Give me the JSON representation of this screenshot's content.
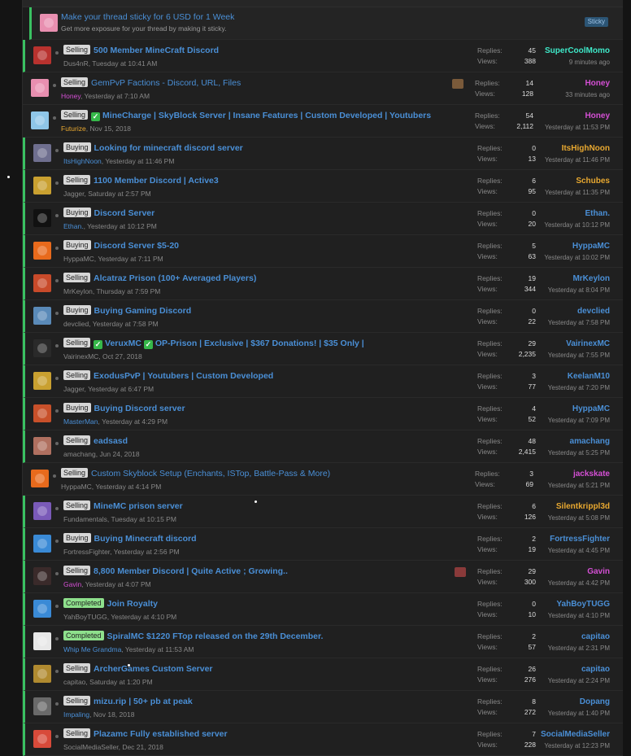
{
  "sticky_ad": {
    "title": "Make your thread sticky for 6 USD for 1 Week",
    "subtitle": "Get more exposure for your thread by making it sticky.",
    "button": "Sticky"
  },
  "labels": {
    "replies": "Replies:",
    "views": "Views:"
  },
  "threads": [
    {
      "prefix": "Selling",
      "title": "500 Member MineCraft Discord",
      "author": "Dus4nR",
      "author_color": "#888888",
      "date": "Tuesday at 10:41 AM",
      "replies": "45",
      "views": "388",
      "last_user": "SuperCoolMomo",
      "last_color": "#3ee8c8",
      "last_time": "9 minutes ago",
      "avatar": "#b8322e",
      "green": true
    },
    {
      "prefix": "Selling",
      "title": "GemPvP Factions - Discord, URL, Files",
      "normal": true,
      "author": "Honey",
      "author_color": "#d44fd4",
      "date": "Yesterday at 7:10 AM",
      "replies": "14",
      "views": "128",
      "last_user": "Honey",
      "last_color": "#d44fd4",
      "last_time": "33 minutes ago",
      "avatar": "#e88fb0",
      "tag": "#7a5a3a",
      "green": false
    },
    {
      "prefix": "Selling",
      "checks": [
        0
      ],
      "title_parts": [
        "MineCharge",
        "| SkyBlock Server | Insane Features | Custom Developed | Youtubers"
      ],
      "author": "Futurize",
      "author_color": "#e8a830",
      "date": "Nov 15, 2018",
      "replies": "54",
      "views": "2,112",
      "last_user": "Honey",
      "last_color": "#d44fd4",
      "last_time": "Yesterday at 11:53 PM",
      "avatar": "#8fc6e8",
      "green": false
    },
    {
      "prefix": "Buying",
      "title": "Looking for minecraft discord server",
      "author": "ItsHighNoon",
      "author_color": "#4a8fd6",
      "date": "Yesterday at 11:46 PM",
      "replies": "0",
      "views": "13",
      "last_user": "ItsHighNoon",
      "last_color": "#e8a830",
      "last_time": "Yesterday at 11:46 PM",
      "avatar": "#6f6f8f",
      "green": true
    },
    {
      "prefix": "Selling",
      "title": "1100 Member Discord | Active3",
      "author": "Jagger",
      "author_color": "#888888",
      "date": "Saturday at 2:57 PM",
      "replies": "6",
      "views": "95",
      "last_user": "Schubes",
      "last_color": "#e8a830",
      "last_time": "Yesterday at 11:35 PM",
      "avatar": "#c9a030",
      "green": true
    },
    {
      "prefix": "Buying",
      "title": "Discord Server",
      "author": "Ethan.",
      "author_color": "#4a8fd6",
      "date": "Yesterday at 10:12 PM",
      "replies": "0",
      "views": "20",
      "last_user": "Ethan.",
      "last_color": "#4a8fd6",
      "last_time": "Yesterday at 10:12 PM",
      "avatar": "#111111",
      "green": true
    },
    {
      "prefix": "Buying",
      "title": "Discord Server $5-20",
      "author": "HyppaMC",
      "author_color": "#888888",
      "date": "Yesterday at 7:11 PM",
      "replies": "5",
      "views": "63",
      "last_user": "HyppaMC",
      "last_color": "#4a8fd6",
      "last_time": "Yesterday at 10:02 PM",
      "avatar": "#e86a1c",
      "green": true
    },
    {
      "prefix": "Selling",
      "title": "Alcatraz Prison (100+ Averaged Players)",
      "author": "MrKeylon",
      "author_color": "#888888",
      "date": "Thursday at 7:59 PM",
      "replies": "19",
      "views": "344",
      "last_user": "MrKeylon",
      "last_color": "#4a8fd6",
      "last_time": "Yesterday at 8:04 PM",
      "avatar": "#c84a2a",
      "green": true
    },
    {
      "prefix": "Buying",
      "title": "Buying Gaming Discord",
      "author": "devclied",
      "author_color": "#888888",
      "date": "Yesterday at 7:58 PM",
      "replies": "0",
      "views": "22",
      "last_user": "devclied",
      "last_color": "#4a8fd6",
      "last_time": "Yesterday at 7:58 PM",
      "avatar": "#5a8ab8",
      "green": true
    },
    {
      "prefix": "Selling",
      "checks": [
        0,
        1
      ],
      "title_parts": [
        "VeruxMC",
        "OP-Prison | Exclusive | $367 Donations! | $35 Only |"
      ],
      "author": "VairinexMC",
      "author_color": "#888888",
      "date": "Oct 27, 2018",
      "replies": "29",
      "views": "2,235",
      "last_user": "VairinexMC",
      "last_color": "#4a8fd6",
      "last_time": "Yesterday at 7:55 PM",
      "avatar": "#2a2a2a",
      "green": true
    },
    {
      "prefix": "Selling",
      "title": "ExodusPvP | Youtubers | Custom Developed",
      "author": "Jagger",
      "author_color": "#888888",
      "date": "Yesterday at 6:47 PM",
      "replies": "3",
      "views": "77",
      "last_user": "KeelanM10",
      "last_color": "#4a8fd6",
      "last_time": "Yesterday at 7:20 PM",
      "avatar": "#c9a030",
      "green": true
    },
    {
      "prefix": "Buying",
      "title": "Buying Discord server",
      "author": "MasterMan",
      "author_color": "#4a8fd6",
      "date": "Yesterday at 4:29 PM",
      "replies": "4",
      "views": "52",
      "last_user": "HyppaMC",
      "last_color": "#4a8fd6",
      "last_time": "Yesterday at 7:09 PM",
      "avatar": "#c8502a",
      "green": true
    },
    {
      "prefix": "Selling",
      "title": "eadsasd",
      "author": "amachang",
      "author_color": "#888888",
      "date": "Jun 24, 2018",
      "replies": "48",
      "views": "2,415",
      "last_user": "amachang",
      "last_color": "#4a8fd6",
      "last_time": "Yesterday at 5:25 PM",
      "avatar": "#b07060",
      "green": true
    },
    {
      "prefix": "Selling",
      "title": "Custom Skyblock Setup (Enchants, ISTop, Battle-Pass & More)",
      "normal": true,
      "author": "HyppaMC",
      "author_color": "#888888",
      "date": "Yesterday at 4:14 PM",
      "replies": "3",
      "views": "69",
      "last_user": "jackskate",
      "last_color": "#d44fd4",
      "last_time": "Yesterday at 5:21 PM",
      "avatar": "#e86a1c",
      "green": false
    },
    {
      "prefix": "Selling",
      "title": "MineMC prison server",
      "author": "Fundamentals",
      "author_color": "#888888",
      "date": "Tuesday at 10:15 PM",
      "replies": "6",
      "views": "126",
      "last_user": "Silentkrippl3d",
      "last_color": "#e8a830",
      "last_time": "Yesterday at 5:08 PM",
      "avatar": "#7a5ab8",
      "green": true
    },
    {
      "prefix": "Buying",
      "title": "Buying Minecraft discord",
      "author": "FortressFighter",
      "author_color": "#888888",
      "date": "Yesterday at 2:56 PM",
      "replies": "2",
      "views": "19",
      "last_user": "FortressFighter",
      "last_color": "#4a8fd6",
      "last_time": "Yesterday at 4:45 PM",
      "avatar": "#3a8ad6",
      "green": true
    },
    {
      "prefix": "Selling",
      "title": "8,800 Member Discord | Quite Active ; Growing..",
      "author": "Gavin",
      "author_color": "#d44fd4",
      "date": "Yesterday at 4:07 PM",
      "replies": "29",
      "views": "300",
      "last_user": "Gavin",
      "last_color": "#d44fd4",
      "last_time": "Yesterday at 4:42 PM",
      "avatar": "#3a2a2a",
      "tag": "#8a3a3a",
      "green": true
    },
    {
      "prefix": "Completed",
      "title": "Join Royalty",
      "author": "YahBoyTUGG",
      "author_color": "#888888",
      "date": "Yesterday at 4:10 PM",
      "replies": "0",
      "views": "10",
      "last_user": "YahBoyTUGG",
      "last_color": "#4a8fd6",
      "last_time": "Yesterday at 4:10 PM",
      "avatar": "#3a8ad6",
      "green": true
    },
    {
      "prefix": "Completed",
      "title": "SpiralMC $1220 FTop released on the 29th December.",
      "author": "Whip Me Grandma",
      "author_color": "#4a8fd6",
      "date": "Yesterday at 11:53 AM",
      "replies": "2",
      "views": "57",
      "last_user": "capitao",
      "last_color": "#4a8fd6",
      "last_time": "Yesterday at 2:31 PM",
      "avatar": "#e8e8e8",
      "green": true
    },
    {
      "prefix": "Selling",
      "title": "ArcherGames Custom Server",
      "author": "capitao",
      "author_color": "#888888",
      "date": "Saturday at 1:20 PM",
      "replies": "26",
      "views": "276",
      "last_user": "capitao",
      "last_color": "#4a8fd6",
      "last_time": "Yesterday at 2:24 PM",
      "avatar": "#b08a30",
      "green": true
    },
    {
      "prefix": "Selling",
      "title": "mizu.rip | 50+ pb at peak",
      "author": "Impaling",
      "author_color": "#4a8fd6",
      "date": "Nov 18, 2018",
      "replies": "8",
      "views": "272",
      "last_user": "Dopang",
      "last_color": "#4a8fd6",
      "last_time": "Yesterday at 1:40 PM",
      "avatar": "#6a6a6a",
      "green": true
    },
    {
      "prefix": "Selling",
      "title": "Plazamc Fully established server",
      "author": "SocialMediaSeller",
      "author_color": "#888888",
      "date": "Dec 21, 2018",
      "replies": "7",
      "views": "228",
      "last_user": "SocialMediaSeller",
      "last_color": "#4a8fd6",
      "last_time": "Yesterday at 12:23 PM",
      "avatar": "#d84a3a",
      "green": true
    }
  ]
}
